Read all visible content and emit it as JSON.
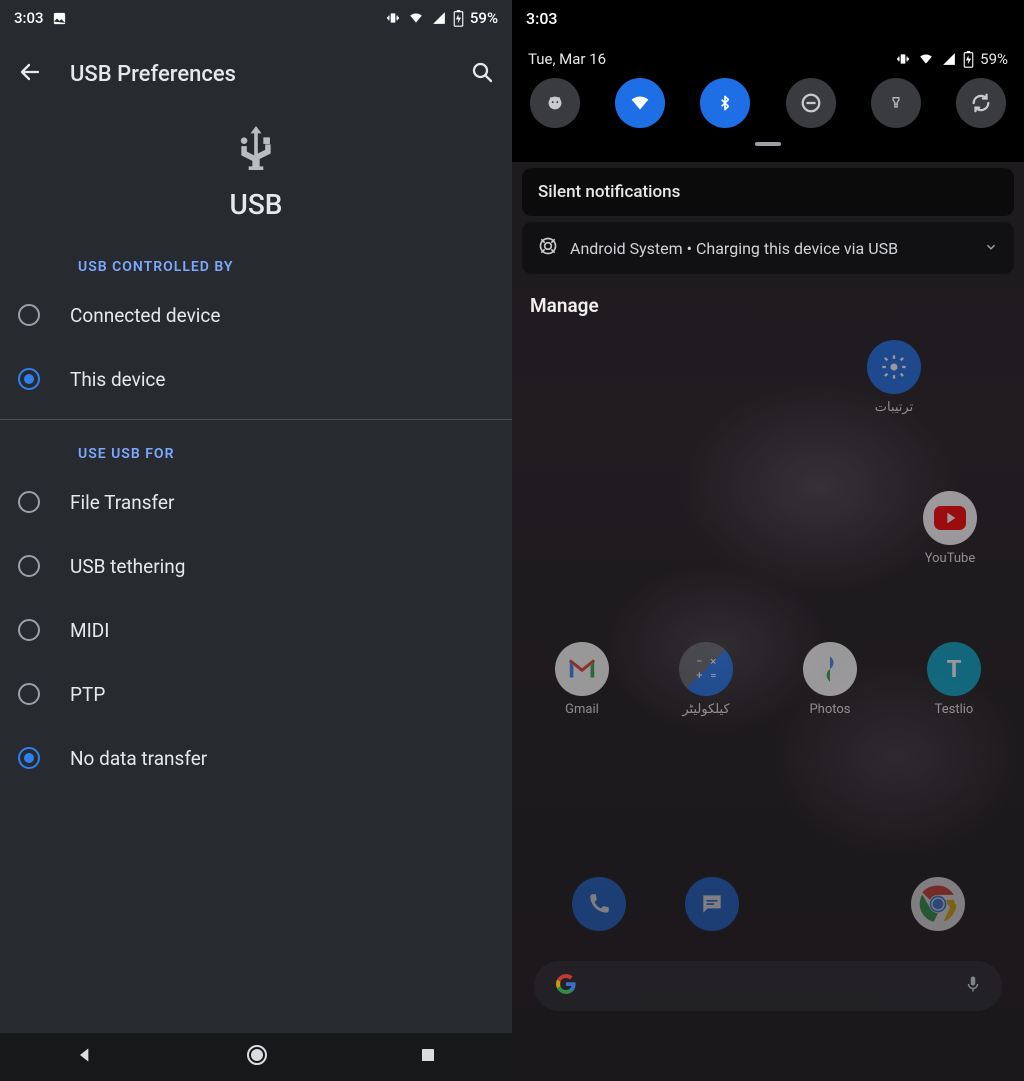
{
  "left": {
    "status": {
      "time": "3:03",
      "battery": "59%"
    },
    "screen_title": "USB Preferences",
    "hero_label": "USB",
    "sections": {
      "controlled_by": {
        "title": "USB CONTROLLED BY",
        "options": [
          {
            "label": "Connected device",
            "selected": false
          },
          {
            "label": "This device",
            "selected": true
          }
        ]
      },
      "use_for": {
        "title": "USE USB FOR",
        "options": [
          {
            "label": "File Transfer",
            "selected": false
          },
          {
            "label": "USB tethering",
            "selected": false
          },
          {
            "label": "MIDI",
            "selected": false
          },
          {
            "label": "PTP",
            "selected": false
          },
          {
            "label": "No data transfer",
            "selected": true
          }
        ]
      }
    }
  },
  "right": {
    "status": {
      "time": "3:03",
      "battery": "59%"
    },
    "date": "Tue, Mar 16",
    "qs_tiles": [
      {
        "name": "android-head-icon",
        "active": false
      },
      {
        "name": "wifi-icon",
        "active": true
      },
      {
        "name": "bluetooth-icon",
        "active": true
      },
      {
        "name": "dnd-icon",
        "active": false
      },
      {
        "name": "flashlight-icon",
        "active": false
      },
      {
        "name": "rotate-icon",
        "active": false
      }
    ],
    "silent_header": "Silent notifications",
    "notification": {
      "app": "Android System",
      "separator": " • ",
      "text": "Charging this device via USB"
    },
    "manage_label": "Manage",
    "apps": {
      "row1": [
        {
          "label": "ترتیبات"
        }
      ],
      "row2": [
        {
          "label": "YouTube"
        }
      ],
      "row3": [
        {
          "label": "Gmail"
        },
        {
          "label": "کیلکولیٹر"
        },
        {
          "label": "Photos"
        },
        {
          "label": "Testlio"
        }
      ],
      "dock": [
        {
          "name": "phone-icon"
        },
        {
          "name": "messages-icon"
        },
        {
          "name": "spacer"
        },
        {
          "name": "chrome-icon"
        }
      ]
    }
  }
}
